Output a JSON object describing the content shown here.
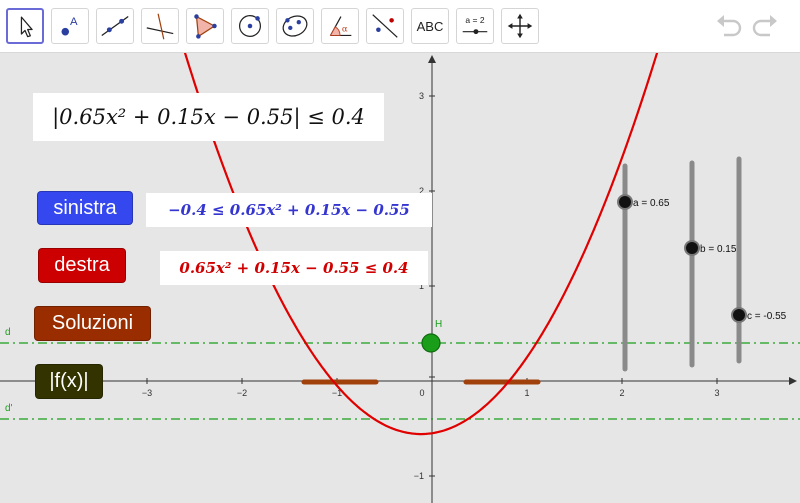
{
  "toolbar": {
    "tools": [
      {
        "name": "move-tool",
        "icon": "arrow-pointer-icon"
      },
      {
        "name": "point-tool",
        "icon": "point-icon",
        "label": "A"
      },
      {
        "name": "line-tool",
        "icon": "line-through-points-icon"
      },
      {
        "name": "perpendicular-tool",
        "icon": "perpendicular-line-icon"
      },
      {
        "name": "polygon-tool",
        "icon": "polygon-icon"
      },
      {
        "name": "circle-tool",
        "icon": "circle-center-point-icon"
      },
      {
        "name": "conic-tool",
        "icon": "ellipse-icon"
      },
      {
        "name": "angle-tool",
        "icon": "angle-icon",
        "label": "α"
      },
      {
        "name": "reflect-tool",
        "icon": "reflect-about-line-icon"
      },
      {
        "name": "text-tool",
        "icon": "text-icon",
        "label": "ABC"
      },
      {
        "name": "slider-tool",
        "icon": "slider-icon",
        "label": "a = 2"
      },
      {
        "name": "move-graphics-tool",
        "icon": "move-graphics-view-icon"
      }
    ],
    "undo_icon": "undo-icon",
    "redo_icon": "redo-icon"
  },
  "formulas": {
    "main": "|0.65x² + 0.15x − 0.55| ≤ 0.4",
    "left": "−0.4 ≤ 0.65x² + 0.15x − 0.55",
    "right": "0.65x² + 0.15x − 0.55 ≤ 0.4"
  },
  "buttons": {
    "sinistra": "sinistra",
    "destra": "destra",
    "soluzioni": "Soluzioni",
    "abs": "|f(x)|"
  },
  "graph": {
    "point_label": "H",
    "line_d": "d",
    "line_d_prime": "d'",
    "x_ticks": [
      "−3",
      "−2",
      "−1",
      "0",
      "1",
      "2",
      "3"
    ],
    "y_ticks": [
      "3",
      "2",
      "1",
      "−1"
    ],
    "sliders": [
      {
        "label": "a = 0.65",
        "value": 0.65
      },
      {
        "label": "b = 0.15",
        "value": 0.15
      },
      {
        "label": "c = -0.55",
        "value": -0.55
      }
    ]
  },
  "colors": {
    "curve": "#e00000",
    "blue_button": "#3548f0",
    "red_button": "#cc0000",
    "brown_button": "#992d00",
    "dark_button": "#333300",
    "solution_segments": "#a0410c",
    "dashed_lines": "#1a9e1a",
    "point_H": "#1a9e1a",
    "left_formula_text": "#3535d0",
    "right_formula_text": "#d00000"
  }
}
